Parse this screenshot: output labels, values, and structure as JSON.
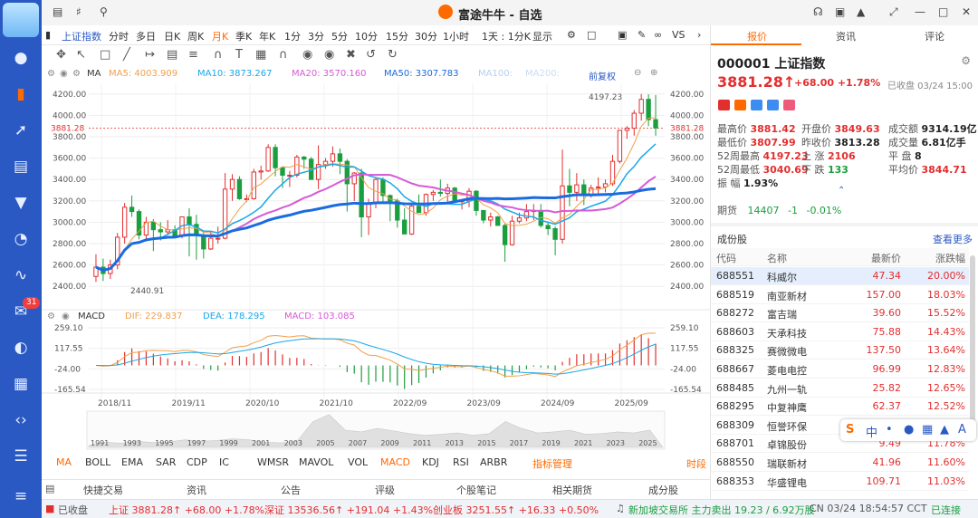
{
  "window": {
    "title": "富途牛牛 - 自选"
  },
  "left_nav": {
    "badge": "31"
  },
  "period_toolbar": {
    "index_name": "上证指数",
    "periods": [
      "分时",
      "多日",
      "日K",
      "周K",
      "月K",
      "季K",
      "年K",
      "1分",
      "3分",
      "5分",
      "10分",
      "15分",
      "30分",
      "1小时",
      "1天 : 1分K",
      "显示",
      "VS"
    ],
    "selected": "月K"
  },
  "ma_legend": {
    "ma_label": "MA",
    "ma5": "MA5: 4003.909",
    "ma10": "MA10: 3873.267",
    "ma20": "MA20: 3570.160",
    "ma50": "MA50: 3307.783",
    "ma100": "MA100:",
    "ma200": "MA200:",
    "fq": "前复权"
  },
  "chart_axes": {
    "price_ticks": [
      "4200.00",
      "4000.00",
      "3800.00",
      "3600.00",
      "3400.00",
      "3200.00",
      "3000.00",
      "2800.00",
      "2600.00",
      "2400.00"
    ],
    "current_price": "3881.28",
    "high_label": "4197.23",
    "low_label": "2440.91",
    "date_ticks": [
      "2018/11",
      "2019/11",
      "2020/10",
      "2021/10",
      "2022/09",
      "2023/09",
      "2024/09",
      "2025/09"
    ],
    "overview_years": [
      "1991",
      "1993",
      "1995",
      "1997",
      "1999",
      "2001",
      "2003",
      "2005",
      "2007",
      "2009",
      "2011",
      "2013",
      "2015",
      "2017",
      "2019",
      "2021",
      "2023",
      "2025"
    ]
  },
  "macd_legend": {
    "label": "MACD",
    "dif": "DIF: 229.837",
    "dea": "DEA: 178.295",
    "macd": "MACD: 103.085",
    "ticks": [
      "259.10",
      "117.55",
      "-24.00",
      "-165.54"
    ]
  },
  "indicator_tabs": [
    "MA",
    "BOLL",
    "EMA",
    "SAR",
    "CDP",
    "IC",
    "WMSR",
    "MAVOL",
    "VOL",
    "MACD",
    "KDJ",
    "RSI",
    "ARBR",
    "指标管理",
    "时段"
  ],
  "bottom_tabs": [
    "快捷交易",
    "资讯",
    "公告",
    "评级",
    "个股笔记",
    "相关期货",
    "成分股"
  ],
  "status_bar": {
    "market_state": "已收盘",
    "sh": "上证 3881.28↑ +68.00 +1.78%",
    "sz": "深证 13536.56↑ +191.04 +1.43%",
    "cy": "创业板 3251.55↑ +16.33 +0.50%",
    "sgx": "新加坡交易所 主力卖出 19.23 / 6.92万股",
    "time": "CN 03/24 18:54:57 CCT",
    "conn": "已连接"
  },
  "right_panel": {
    "tabs": [
      "报价",
      "资讯",
      "评论"
    ],
    "symbol": "000001 上证指数",
    "price": "3881.28↑",
    "change": "+68.00 +1.78%",
    "closed_time": "已收盘 03/24 15:00",
    "quote": [
      {
        "k": "最高价",
        "v": "3881.42",
        "c": "red"
      },
      {
        "k": "开盘价",
        "v": "3849.63",
        "c": "red"
      },
      {
        "k": "成交额",
        "v": "9314.19亿",
        "c": "dark"
      },
      {
        "k": "最低价",
        "v": "3807.99",
        "c": "red"
      },
      {
        "k": "昨收价",
        "v": "3813.28",
        "c": "dark"
      },
      {
        "k": "成交量",
        "v": "6.81亿手",
        "c": "dark"
      },
      {
        "k": "52周最高",
        "v": "4197.23",
        "c": "red"
      },
      {
        "k": "上 涨",
        "v": "2106",
        "c": "red"
      },
      {
        "k": "平 盘",
        "v": "8",
        "c": "dark"
      },
      {
        "k": "52周最低",
        "v": "3040.69",
        "c": "red"
      },
      {
        "k": "下 跌",
        "v": "133",
        "c": "green"
      },
      {
        "k": "平均价",
        "v": "3844.71",
        "c": "red"
      },
      {
        "k": "振 幅",
        "v": "1.93%",
        "c": "dark"
      }
    ],
    "futures": {
      "label": "期货",
      "v1": "14407",
      "v2": "-1",
      "v3": "-0.01%"
    },
    "constituents_title": "成份股",
    "more_label": "查看更多",
    "constituents_header": [
      "代码",
      "名称",
      "最新价",
      "涨跌幅"
    ],
    "constituents": [
      {
        "code": "688551",
        "name": "科威尔",
        "price": "47.34",
        "pct": "20.00%"
      },
      {
        "code": "688519",
        "name": "南亚新材",
        "price": "157.00",
        "pct": "18.03%"
      },
      {
        "code": "688272",
        "name": "富吉瑞",
        "price": "39.60",
        "pct": "15.52%"
      },
      {
        "code": "688603",
        "name": "天承科技",
        "price": "75.88",
        "pct": "14.43%"
      },
      {
        "code": "688325",
        "name": "赛微微电",
        "price": "137.50",
        "pct": "13.64%"
      },
      {
        "code": "688667",
        "name": "菱电电控",
        "price": "96.99",
        "pct": "12.83%"
      },
      {
        "code": "688485",
        "name": "九州一轨",
        "price": "25.82",
        "pct": "12.65%"
      },
      {
        "code": "688295",
        "name": "中复神鹰",
        "price": "62.37",
        "pct": "12.52%"
      },
      {
        "code": "688309",
        "name": "恒誉环保",
        "price": "",
        "pct": ""
      },
      {
        "code": "688701",
        "name": "卓锦股份",
        "price": "9.49",
        "pct": "11.78%"
      },
      {
        "code": "688550",
        "name": "瑞联新材",
        "price": "41.96",
        "pct": "11.60%"
      },
      {
        "code": "688353",
        "name": "华盛锂电",
        "price": "109.71",
        "pct": "11.03%"
      }
    ]
  },
  "ime": {
    "text": "中"
  },
  "colors": {
    "up": "#e32e2e",
    "down": "#1b9e3e",
    "ma5": "#f0a04b",
    "ma10": "#1aa7e8",
    "ma20": "#d65ad6",
    "ma50": "#1a6be0",
    "accent": "#ff6a00",
    "nav": "#2a59c4"
  },
  "chart_data": {
    "type": "candlestick",
    "title": "上证指数 月K",
    "ylim": [
      2300,
      4300
    ],
    "candles": [
      [
        2493,
        2700,
        2440.91,
        2580
      ],
      [
        2580,
        2660,
        2450,
        2520
      ],
      [
        2520,
        2650,
        2470,
        2600
      ],
      [
        2600,
        2900,
        2560,
        2860
      ],
      [
        2860,
        3180,
        2800,
        3140
      ],
      [
        3140,
        3250,
        3050,
        3100
      ],
      [
        3100,
        3120,
        2840,
        2880
      ],
      [
        2880,
        3050,
        2820,
        3000
      ],
      [
        3000,
        3030,
        2730,
        2930
      ],
      [
        2930,
        3000,
        2830,
        2910
      ],
      [
        2910,
        3020,
        2880,
        2930
      ],
      [
        2930,
        2970,
        2860,
        2870
      ],
      [
        2870,
        3050,
        2850,
        3050
      ],
      [
        3050,
        3130,
        2680,
        2980
      ],
      [
        2980,
        3070,
        2650,
        2880
      ],
      [
        2880,
        2900,
        2660,
        2750
      ],
      [
        2750,
        2920,
        2740,
        2850
      ],
      [
        2850,
        2960,
        2800,
        2850
      ],
      [
        2850,
        3460,
        2840,
        3310
      ],
      [
        3310,
        3450,
        3200,
        3400
      ],
      [
        3400,
        3430,
        3210,
        3220
      ],
      [
        3220,
        3260,
        3190,
        3220
      ],
      [
        3220,
        3500,
        3210,
        3470
      ],
      [
        3470,
        3530,
        3400,
        3480
      ],
      [
        3480,
        3730,
        3470,
        3700
      ],
      [
        3700,
        3730,
        3430,
        3510
      ],
      [
        3510,
        3500,
        3320,
        3440
      ],
      [
        3440,
        3480,
        3330,
        3440
      ],
      [
        3440,
        3630,
        3420,
        3610
      ],
      [
        3610,
        3620,
        3500,
        3590
      ],
      [
        3590,
        3610,
        3400,
        3400
      ],
      [
        3400,
        3720,
        3310,
        3540
      ],
      [
        3540,
        3600,
        3500,
        3570
      ],
      [
        3570,
        3710,
        3520,
        3640
      ],
      [
        3640,
        3690,
        3450,
        3570
      ],
      [
        3570,
        3590,
        3100,
        3360
      ],
      [
        3360,
        3470,
        3200,
        3460
      ],
      [
        3460,
        3500,
        2860,
        3050
      ],
      [
        3050,
        3220,
        2880,
        3180
      ],
      [
        3180,
        3420,
        3130,
        3400
      ],
      [
        3400,
        3420,
        3180,
        3250
      ],
      [
        3250,
        3260,
        3010,
        3200
      ],
      [
        3200,
        3220,
        2950,
        3020
      ],
      [
        3020,
        3130,
        2890,
        2890
      ],
      [
        2890,
        3160,
        2880,
        3150
      ],
      [
        3150,
        3260,
        3090,
        3090
      ],
      [
        3090,
        3270,
        3060,
        3260
      ],
      [
        3260,
        3300,
        3200,
        3280
      ],
      [
        3280,
        3400,
        3240,
        3270
      ],
      [
        3270,
        3360,
        3180,
        3320
      ],
      [
        3320,
        3330,
        3180,
        3200
      ],
      [
        3200,
        3210,
        3120,
        3200
      ],
      [
        3200,
        3320,
        3140,
        3290
      ],
      [
        3290,
        3300,
        3060,
        3110
      ],
      [
        3110,
        3110,
        2990,
        3020
      ],
      [
        3020,
        3090,
        2960,
        3050
      ],
      [
        3050,
        3060,
        2970,
        2970
      ],
      [
        2970,
        2990,
        2630,
        2790
      ],
      [
        2790,
        3060,
        2780,
        3010
      ],
      [
        3010,
        3090,
        2990,
        3040
      ],
      [
        3040,
        3170,
        3010,
        3100
      ],
      [
        3100,
        3170,
        3020,
        3110
      ],
      [
        3110,
        3170,
        2950,
        2970
      ],
      [
        2970,
        3000,
        2880,
        2940
      ],
      [
        2940,
        2960,
        2690,
        2840
      ],
      [
        2840,
        3680,
        2800,
        3340
      ],
      [
        3340,
        3500,
        3150,
        3280
      ],
      [
        3280,
        3460,
        3200,
        3350
      ],
      [
        3350,
        3400,
        3160,
        3250
      ],
      [
        3250,
        3350,
        3230,
        3320
      ],
      [
        3320,
        3420,
        3260,
        3330
      ],
      [
        3330,
        3400,
        3280,
        3360
      ],
      [
        3360,
        3630,
        3340,
        3570
      ],
      [
        3570,
        3710,
        3550,
        3860
      ],
      [
        3860,
        3900,
        3780,
        3880
      ],
      [
        3880,
        4050,
        3810,
        4020
      ],
      [
        4020,
        4200,
        3950,
        4150
      ],
      [
        4150,
        4197.23,
        3900,
        3960
      ],
      [
        3960,
        4190,
        3810,
        3881.28
      ]
    ],
    "macd": {
      "dif_end": 229.837,
      "dea_end": 178.295,
      "hist_end": 103.085,
      "ylim": [
        -165.54,
        259.1
      ]
    }
  }
}
